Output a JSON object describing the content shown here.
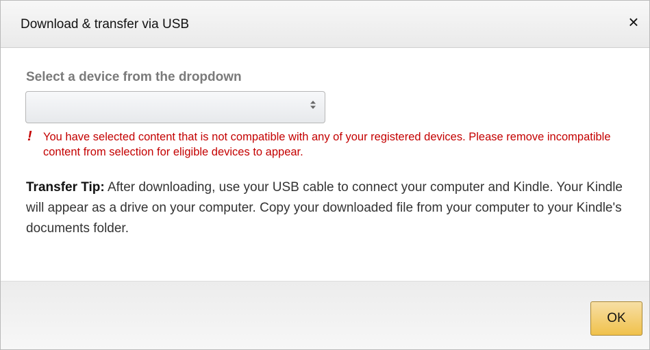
{
  "dialog": {
    "title": "Download & transfer via USB",
    "close_glyph": "×"
  },
  "device_select": {
    "label": "Select a device from the dropdown",
    "selected_value": "",
    "arrows_icon": "sort-arrows-icon"
  },
  "error": {
    "icon": "!",
    "message": "You have selected content that is not compatible with any of your registered devices. Please remove incompatible content from selection for eligible devices to appear."
  },
  "tip": {
    "label": "Transfer Tip:",
    "text": " After downloading, use your USB cable to connect your computer and Kindle. Your Kindle will appear as a drive on your computer. Copy your downloaded file from your computer to your Kindle's documents folder."
  },
  "footer": {
    "ok_label": "OK"
  },
  "colors": {
    "error": "#c40000",
    "ok_button": "#f0c14b"
  }
}
